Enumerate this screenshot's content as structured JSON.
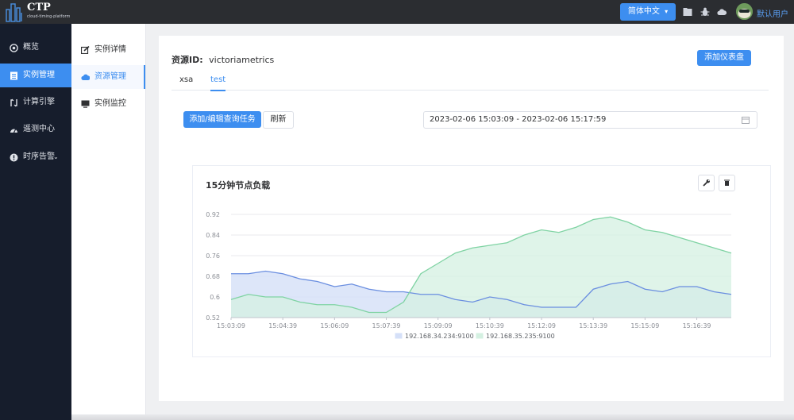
{
  "app": {
    "logo_title": "CTP",
    "logo_subtitle": "cloud-timing-platform",
    "language": "简体中文",
    "user": "默认用户"
  },
  "topbar_icons": [
    "folder-icon",
    "bug-icon",
    "cloud-icon"
  ],
  "sidebar": {
    "items": [
      {
        "label": "概览",
        "icon": "overview-icon"
      },
      {
        "label": "实例管理",
        "icon": "instance-icon"
      },
      {
        "label": "计算引擎",
        "icon": "engine-icon"
      },
      {
        "label": "遥测中心",
        "icon": "telemetry-icon"
      },
      {
        "label": "时序告警",
        "icon": "alert-icon"
      }
    ],
    "active_index": 1
  },
  "subnav": {
    "items": [
      {
        "label": "实例详情",
        "icon": "edit-icon"
      },
      {
        "label": "资源管理",
        "icon": "cloud-icon"
      },
      {
        "label": "实例监控",
        "icon": "monitor-icon"
      }
    ],
    "active_index": 1
  },
  "main": {
    "resource_label": "资源ID:",
    "resource_value": "victoriametrics",
    "add_dashboard": "添加仪表盘",
    "tabs": [
      "xsa",
      "test"
    ],
    "active_tab": 1,
    "add_query_button": "添加/编辑查询任务",
    "refresh_button": "刷新",
    "date_range": "2023-02-06 15:03:09 - 2023-02-06 15:17:59"
  },
  "colors": {
    "accent": "#3d8ef0",
    "series1_line": "#6a8ee0",
    "series1_fill": "#d5e0f8",
    "series2_line": "#7fd3a3",
    "series2_fill": "#d4f0e1"
  },
  "chart_data": {
    "type": "area",
    "title": "15分钟节点负载",
    "xlabel": "",
    "ylabel": "",
    "ylim": [
      0.52,
      0.92
    ],
    "yticks": [
      0.92,
      0.84,
      0.76,
      0.68,
      0.6,
      0.52
    ],
    "x": [
      "15:03:09",
      "15:03:39",
      "15:04:09",
      "15:04:39",
      "15:05:09",
      "15:05:39",
      "15:06:09",
      "15:06:39",
      "15:07:09",
      "15:07:39",
      "15:08:09",
      "15:08:39",
      "15:09:09",
      "15:09:39",
      "15:10:09",
      "15:10:39",
      "15:11:09",
      "15:11:39",
      "15:12:09",
      "15:12:39",
      "15:13:09",
      "15:13:39",
      "15:14:09",
      "15:14:39",
      "15:15:09",
      "15:15:39",
      "15:16:09",
      "15:16:39",
      "15:17:09",
      "15:17:39"
    ],
    "xticks": [
      "15:03:09",
      "15:04:39",
      "15:06:09",
      "15:07:39",
      "15:09:09",
      "15:10:39",
      "15:12:09",
      "15:13:39",
      "15:15:09",
      "15:16:39"
    ],
    "grid": true,
    "legend_position": "bottom",
    "series": [
      {
        "name": "192.168.34.234:9100",
        "values": [
          0.69,
          0.69,
          0.7,
          0.69,
          0.67,
          0.66,
          0.64,
          0.65,
          0.63,
          0.62,
          0.62,
          0.61,
          0.61,
          0.59,
          0.58,
          0.6,
          0.59,
          0.57,
          0.56,
          0.56,
          0.56,
          0.63,
          0.65,
          0.66,
          0.63,
          0.62,
          0.64,
          0.64,
          0.62,
          0.61
        ]
      },
      {
        "name": "192.168.35.235:9100",
        "values": [
          0.59,
          0.61,
          0.6,
          0.6,
          0.58,
          0.57,
          0.57,
          0.56,
          0.54,
          0.54,
          0.58,
          0.69,
          0.73,
          0.77,
          0.79,
          0.8,
          0.81,
          0.84,
          0.86,
          0.85,
          0.87,
          0.9,
          0.91,
          0.89,
          0.86,
          0.85,
          0.83,
          0.81,
          0.79,
          0.77
        ]
      }
    ]
  }
}
